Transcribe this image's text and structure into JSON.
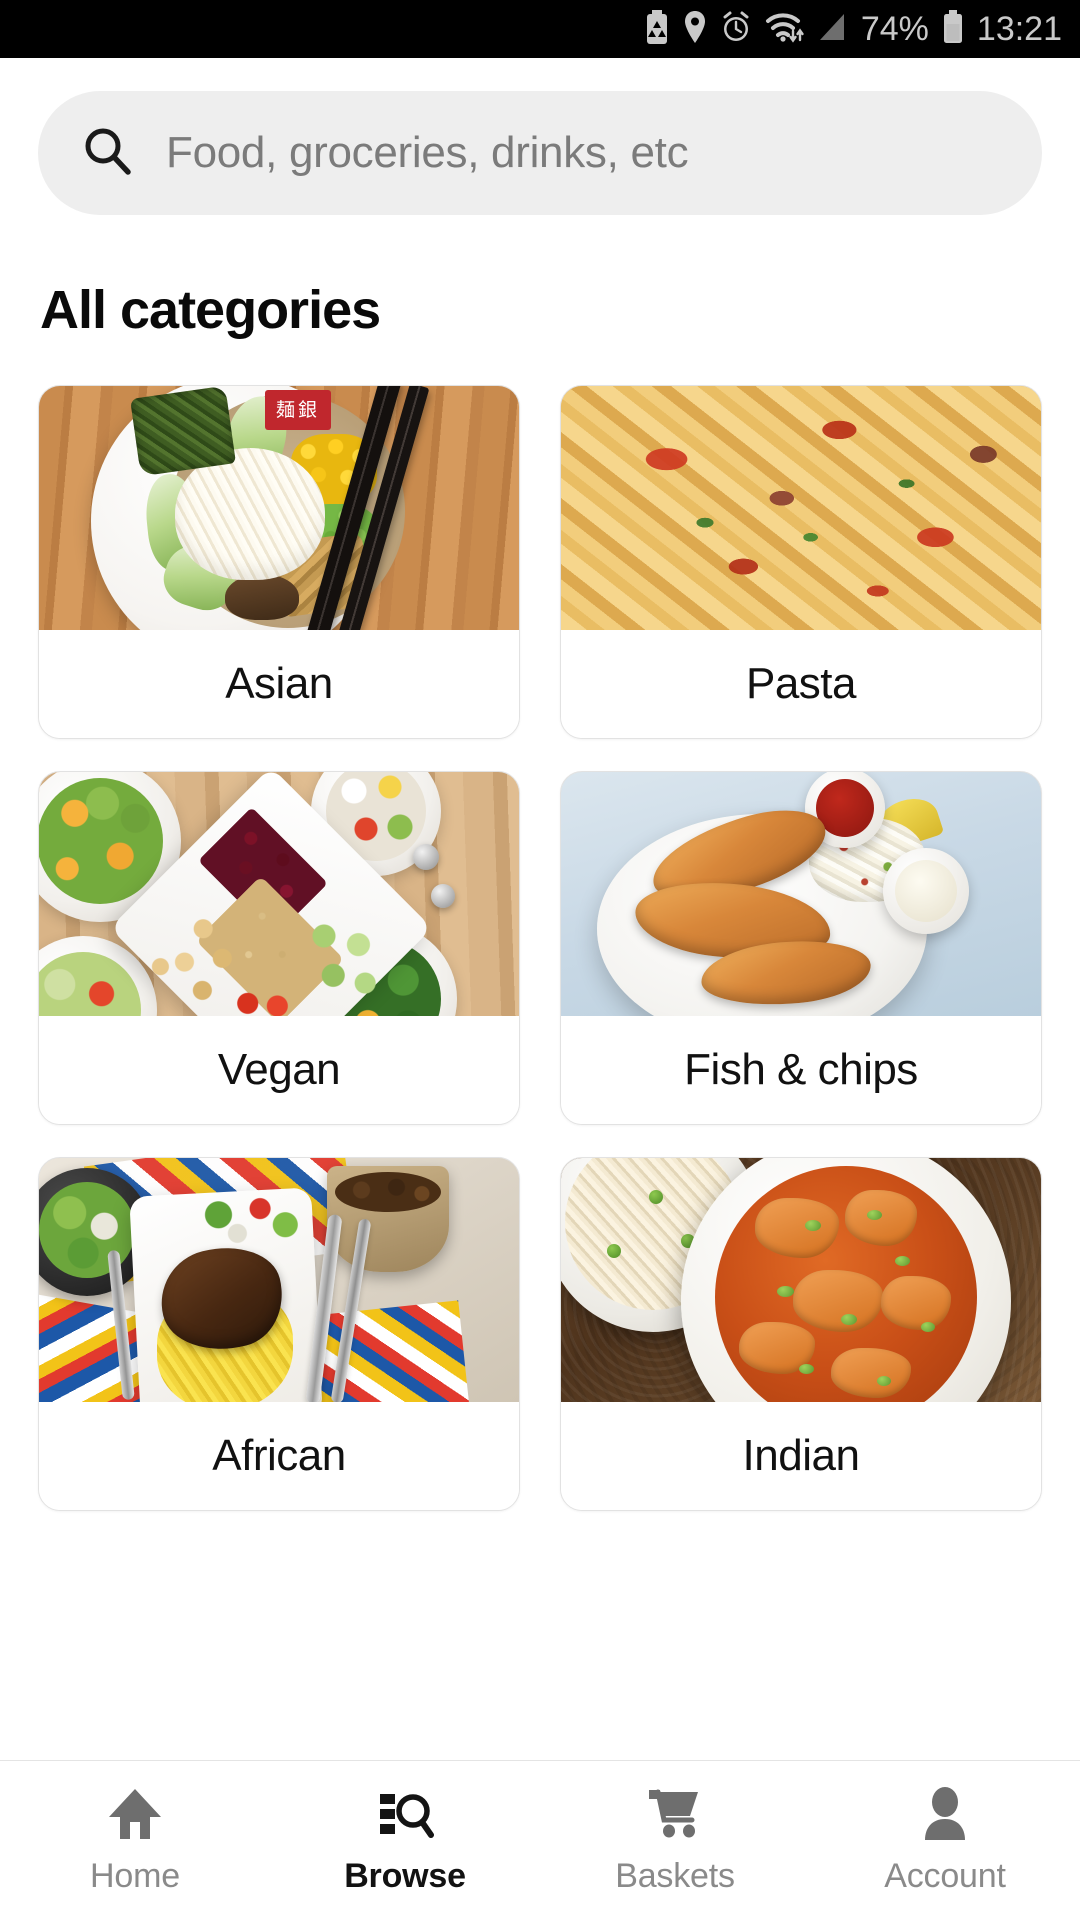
{
  "status_bar": {
    "battery_percent": "74%",
    "time": "13:21",
    "icons": [
      "battery-saver-icon",
      "location-pin-icon",
      "alarm-clock-icon",
      "wifi-icon",
      "cellular-signal-icon",
      "battery-icon"
    ]
  },
  "search": {
    "placeholder": "Food, groceries, drinks, etc",
    "icon": "search-icon"
  },
  "page": {
    "title": "All categories"
  },
  "categories": [
    {
      "label": "Asian",
      "image": "ramen-bowl-photo"
    },
    {
      "label": "Pasta",
      "image": "tagliatelle-tomato-photo"
    },
    {
      "label": "Vegan",
      "image": "quinoa-salad-bowls-photo"
    },
    {
      "label": "Fish & chips",
      "image": "battered-fish-plate-photo"
    },
    {
      "label": "African",
      "image": "grilled-meat-yellow-rice-photo"
    },
    {
      "label": "Indian",
      "image": "curry-and-rice-photo"
    }
  ],
  "bottom_nav": {
    "items": [
      {
        "label": "Home",
        "icon": "home-icon",
        "active": false
      },
      {
        "label": "Browse",
        "icon": "browse-icon",
        "active": true
      },
      {
        "label": "Baskets",
        "icon": "cart-icon",
        "active": false
      },
      {
        "label": "Account",
        "icon": "person-icon",
        "active": false
      }
    ]
  },
  "colors": {
    "background": "#ffffff",
    "search_bg": "#eeeeee",
    "placeholder_text": "#7b7b7b",
    "title_text": "#0a0a0a",
    "nav_inactive": "#8a8a8a",
    "nav_active": "#121212",
    "card_border": "#e2e2e2",
    "status_bar_bg": "#000000"
  }
}
